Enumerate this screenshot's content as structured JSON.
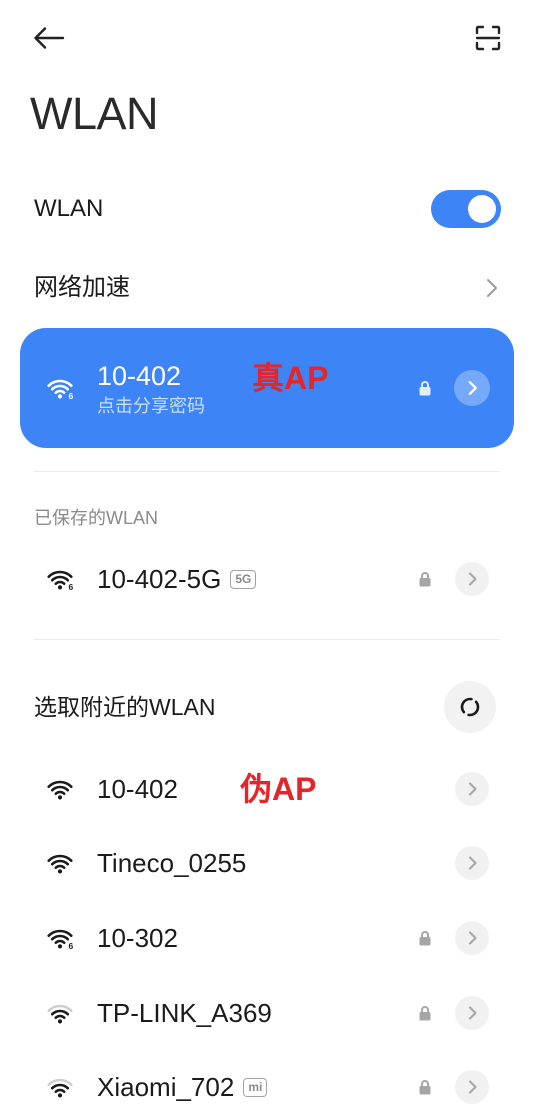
{
  "header": {
    "back_icon": "arrow-left-icon",
    "scan_icon": "scan-icon"
  },
  "page_title": "WLAN",
  "wlan_switch": {
    "label": "WLAN",
    "enabled": true
  },
  "network_acceleration": {
    "label": "网络加速",
    "icon": "chevron-right-icon"
  },
  "connected_network": {
    "ssid": "10-402",
    "subtitle": "点击分享密码",
    "annotation": "真AP",
    "wifi_gen": "6",
    "signal": 3,
    "secured": true
  },
  "saved_networks": {
    "header": "已保存的WLAN",
    "items": [
      {
        "ssid": "10-402-5G",
        "badge": "5G",
        "wifi_gen": "6",
        "signal": 3,
        "secured": true
      }
    ]
  },
  "nearby_networks": {
    "header": "选取附近的WLAN",
    "refresh_icon": "refresh-icon",
    "items": [
      {
        "ssid": "10-402",
        "annotation": "伪AP",
        "signal": 3,
        "secured": false
      },
      {
        "ssid": "Tineco_0255",
        "signal": 3,
        "secured": false
      },
      {
        "ssid": "10-302",
        "wifi_gen": "6",
        "signal": 3,
        "secured": true
      },
      {
        "ssid": "TP-LINK_A369",
        "signal": 2,
        "secured": true
      },
      {
        "ssid": "Xiaomi_702",
        "badge": "mi",
        "signal": 2,
        "secured": true
      }
    ]
  },
  "colors": {
    "accent": "#3d85f6",
    "annotation": "#e3262b"
  }
}
